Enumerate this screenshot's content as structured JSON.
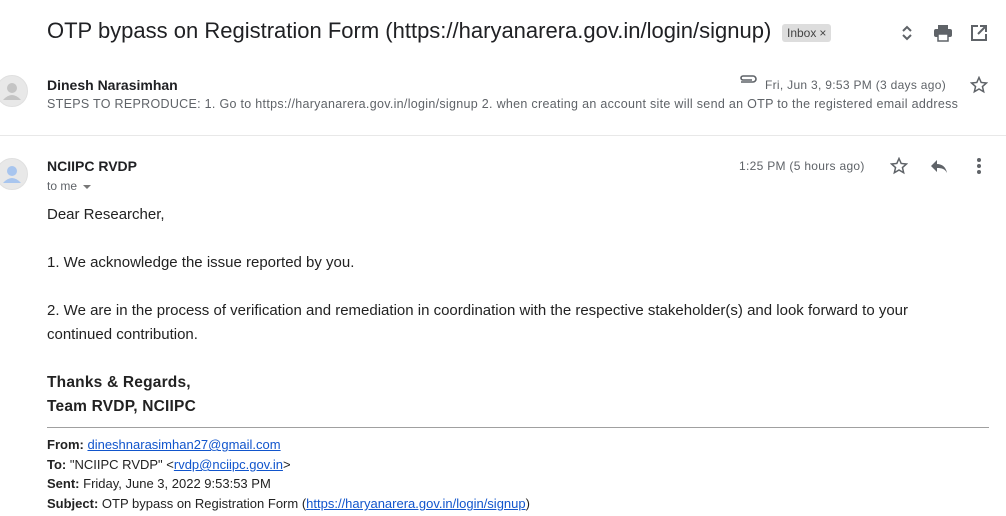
{
  "thread": {
    "subject": "OTP bypass on Registration Form (https://haryanarera.gov.in/login/signup)",
    "label": "Inbox"
  },
  "message1": {
    "sender": "Dinesh Narasimhan",
    "date": "Fri, Jun 3, 9:53 PM (3 days ago)",
    "snippet": "STEPS TO REPRODUCE: 1. Go to https://haryanarera.gov.in/login/signup 2. when creating an account site will send an OTP to the registered email address"
  },
  "message2": {
    "sender": "NCIIPC RVDP",
    "recipient": "to me",
    "date": "1:25 PM (5 hours ago)",
    "greeting": "Dear Researcher,",
    "para1": "1. We acknowledge the issue reported by you.",
    "para2": "2. We are in the process of verification and remediation in coordination with the respective stakeholder(s) and look forward to your continued contribution.",
    "sig1": "Thanks & Regards,",
    "sig2": "Team RVDP, NCIIPC",
    "quoted": {
      "from_label": "From:",
      "from_value": "dineshnarasimhan27@gmail.com",
      "to_label": "To:",
      "to_name": "\"NCIIPC RVDP\" <",
      "to_email": "rvdp@nciipc.gov.in",
      "to_suffix": ">",
      "sent_label": "Sent:",
      "sent_value": "Friday, June 3, 2022 9:53:53 PM",
      "subject_label": "Subject:",
      "subject_text": "OTP bypass on Registration Form (",
      "subject_link": "https://haryanarera.gov.in/login/signup",
      "subject_suffix": ")"
    }
  },
  "icons": [
    "expand-collapse-icon",
    "print-icon",
    "open-in-new-window-icon",
    "attachment-icon",
    "star-icon",
    "reply-icon",
    "more-options-icon",
    "close-icon",
    "dropdown-caret-icon",
    "avatar-icon"
  ]
}
